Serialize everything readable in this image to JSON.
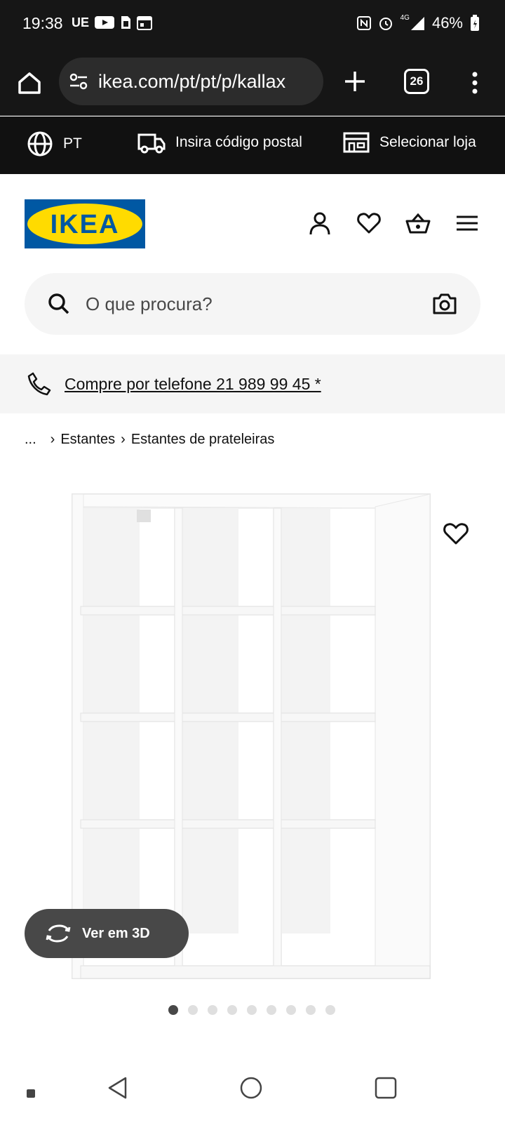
{
  "status_bar": {
    "time": "19:38",
    "carrier_badge": "UE",
    "network": "4G",
    "battery": "46%"
  },
  "browser": {
    "url": "ikea.com/pt/pt/p/kallax",
    "tab_count": "26"
  },
  "utility_bar": {
    "language": "PT",
    "postal_code": "Insira código postal",
    "store": "Selecionar loja"
  },
  "brand": {
    "logo_text": "IKEA",
    "logo_colors": {
      "blue": "#0058a3",
      "yellow": "#ffdb00"
    }
  },
  "search": {
    "placeholder": "O que procura?"
  },
  "phone": {
    "text": "Compre por telefone 21 989 99 45 *"
  },
  "breadcrumb": {
    "ellipsis": "...",
    "items": [
      "Estantes",
      "Estantes de prateleiras"
    ],
    "separator": "›"
  },
  "product_media": {
    "view_3d_label": "Ver em 3D",
    "image_count": 9,
    "active_index": 0
  },
  "icons": [
    "home-icon",
    "tune-icon",
    "plus-icon",
    "tabs-icon",
    "more-vert-icon",
    "globe-icon",
    "truck-icon",
    "store-icon",
    "user-icon",
    "heart-icon",
    "basket-icon",
    "hamburger-icon",
    "search-icon",
    "camera-icon",
    "phone-icon",
    "rotate-3d-icon",
    "back-icon",
    "home-circle-icon",
    "recents-icon"
  ]
}
